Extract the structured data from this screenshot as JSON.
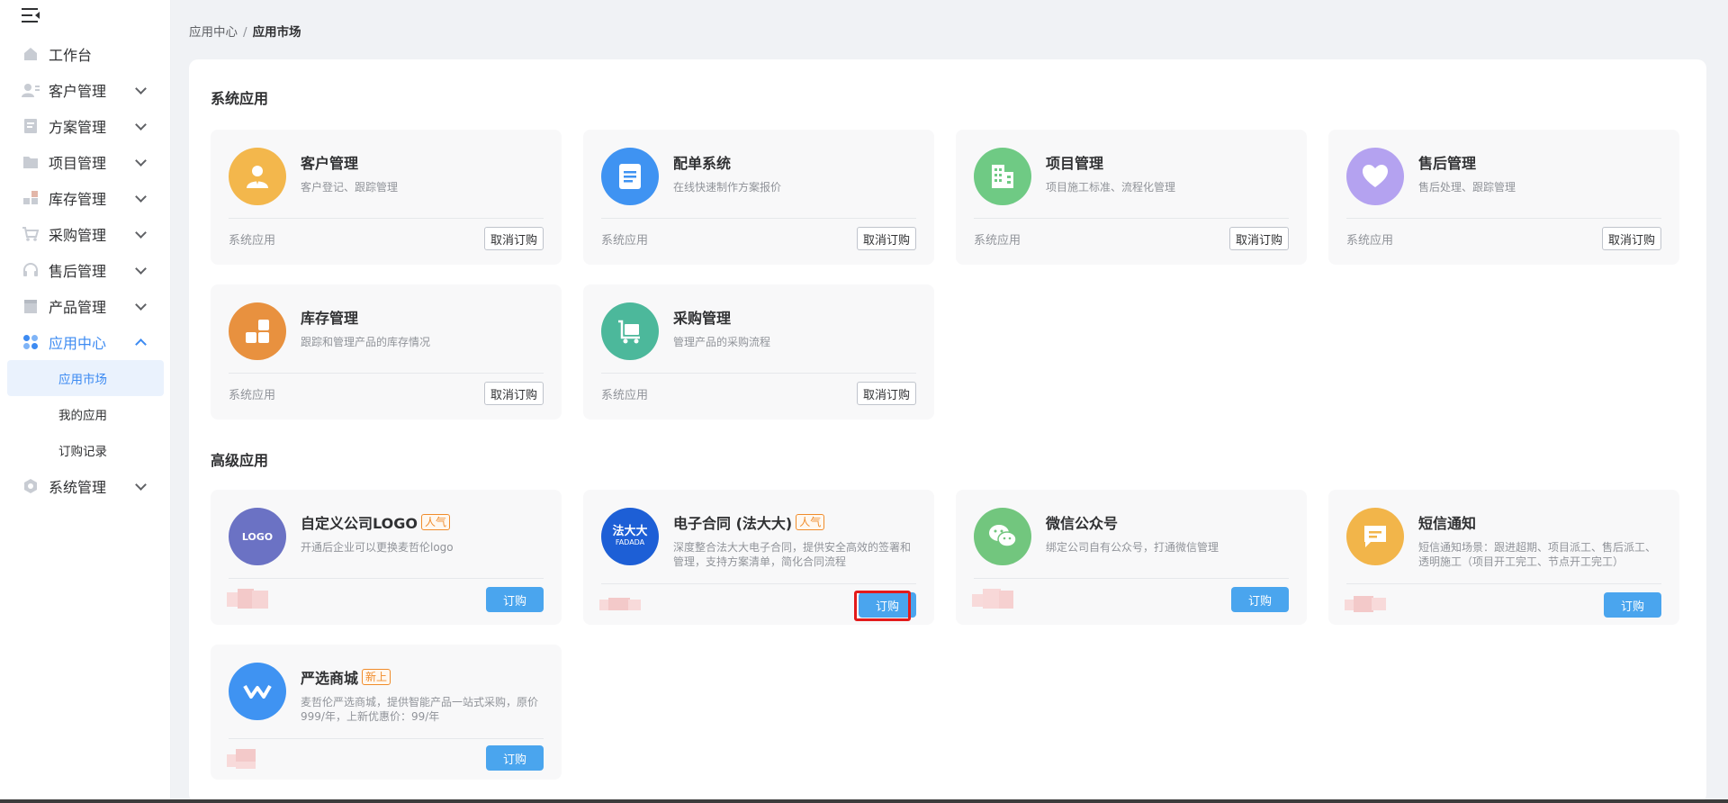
{
  "breadcrumb": {
    "parent": "应用中心",
    "separator": "/",
    "current": "应用市场"
  },
  "sidebar": {
    "items": [
      {
        "label": "工作台",
        "icon": "home-icon"
      },
      {
        "label": "客户管理",
        "icon": "customer-icon"
      },
      {
        "label": "方案管理",
        "icon": "document-icon"
      },
      {
        "label": "项目管理",
        "icon": "folder-icon"
      },
      {
        "label": "库存管理",
        "icon": "inventory-icon"
      },
      {
        "label": "采购管理",
        "icon": "cart-icon"
      },
      {
        "label": "售后管理",
        "icon": "headset-icon"
      },
      {
        "label": "产品管理",
        "icon": "box-icon"
      },
      {
        "label": "应用中心",
        "icon": "apps-icon"
      },
      {
        "label": "系统管理",
        "icon": "settings-icon"
      }
    ],
    "sub_items": [
      "应用市场",
      "我的应用",
      "订购记录"
    ]
  },
  "sections": {
    "system": "系统应用",
    "advanced": "高级应用"
  },
  "system_apps": [
    {
      "name": "客户管理",
      "desc": "客户登记、跟踪管理",
      "footer": "系统应用",
      "action": "取消订购",
      "color": "#f3b74c",
      "icon": "person-icon"
    },
    {
      "name": "配单系统",
      "desc": "在线快速制作方案报价",
      "footer": "系统应用",
      "action": "取消订购",
      "color": "#3f93f2",
      "icon": "document-icon"
    },
    {
      "name": "项目管理",
      "desc": "项目施工标准、流程化管理",
      "footer": "系统应用",
      "action": "取消订购",
      "color": "#6fca84",
      "icon": "building-icon"
    },
    {
      "name": "售后管理",
      "desc": "售后处理、跟踪管理",
      "footer": "系统应用",
      "action": "取消订购",
      "color": "#b4a2f0",
      "icon": "heart-icon"
    },
    {
      "name": "库存管理",
      "desc": "跟踪和管理产品的库存情况",
      "footer": "系统应用",
      "action": "取消订购",
      "color": "#e8913f",
      "icon": "blocks-icon"
    },
    {
      "name": "采购管理",
      "desc": "管理产品的采购流程",
      "footer": "系统应用",
      "action": "取消订购",
      "color": "#4cb89b",
      "icon": "cart-icon"
    }
  ],
  "advanced_apps": [
    {
      "name": "自定义公司LOGO",
      "tag": "人气",
      "desc": "开通后企业可以更换麦哲伦logo",
      "action": "订购",
      "color": "#6b72c4",
      "logo_text": "LOGO",
      "icon": "logo-icon"
    },
    {
      "name": "电子合同 (法大大)",
      "tag": "人气",
      "desc": "深度整合法大大电子合同，提供安全高效的签署和管理，支持方案清单，简化合同流程",
      "action": "订购",
      "color": "#1d5fd6",
      "logo_text": "法大大",
      "logo_sub": "FADADA",
      "icon": "fadada-icon"
    },
    {
      "name": "微信公众号",
      "tag": "",
      "desc": "绑定公司自有公众号，打通微信管理",
      "action": "订购",
      "color": "#72c67e",
      "icon": "wechat-icon"
    },
    {
      "name": "短信通知",
      "tag": "",
      "desc": "短信通知场景：跟进超期、项目派工、售后派工、透明施工（项目开工完工、节点开工完工）",
      "action": "订购",
      "color": "#f2b54a",
      "icon": "message-icon"
    },
    {
      "name": "严选商城",
      "tag": "新上",
      "desc": "麦哲伦严选商城，提供智能产品一站式采购，原价999/年，上新优惠价：99/年",
      "action": "订购",
      "color": "#3f93f2",
      "icon": "mall-icon"
    }
  ]
}
